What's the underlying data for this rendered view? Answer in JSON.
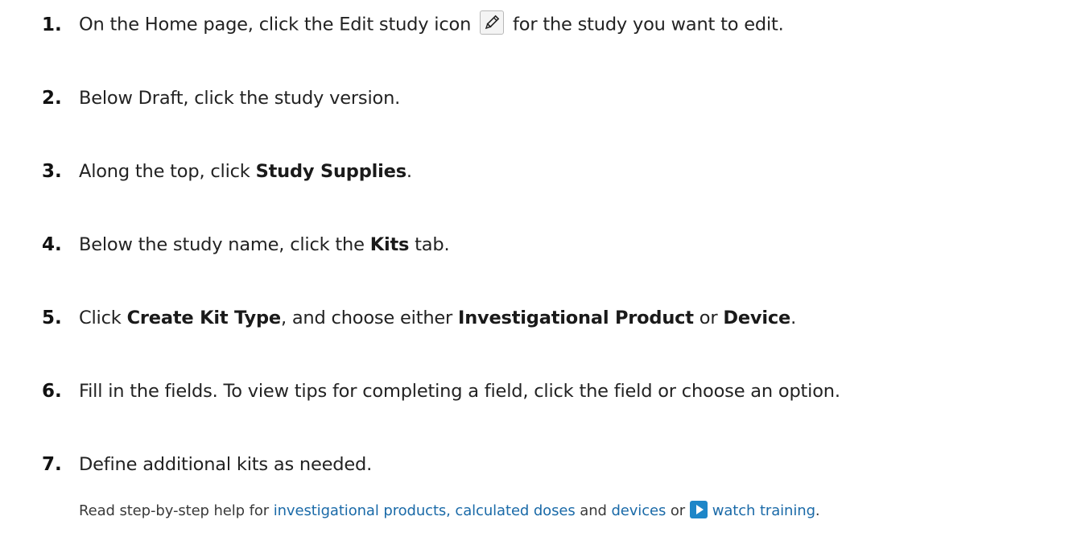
{
  "steps": [
    {
      "num": "1.",
      "parts": [
        "On the Home page, click the Edit study icon",
        "for the study you want to edit."
      ]
    },
    {
      "num": "2.",
      "parts": [
        "Below Draft, click the study version."
      ]
    },
    {
      "num": "3.",
      "parts": [
        "Along the top, click ",
        "Study Supplies",
        "."
      ]
    },
    {
      "num": "4.",
      "parts": [
        "Below the study name, click the ",
        "Kits",
        " tab."
      ]
    },
    {
      "num": "5.",
      "parts": [
        "Click ",
        "Create Kit Type",
        ", and choose either ",
        "Investigational Product",
        " or ",
        "Device",
        "."
      ]
    },
    {
      "num": "6.",
      "parts": [
        "Fill in the fields. To view tips for completing a field, click the field or choose an option."
      ]
    },
    {
      "num": "7.",
      "parts": [
        "Define additional kits as needed."
      ]
    }
  ],
  "help": {
    "prefix": "Read step-by-step help for ",
    "link_products": "investigational products, calculated doses",
    "and": " and ",
    "link_devices": "devices",
    "or": " or ",
    "link_training": "watch training",
    "suffix": "."
  },
  "icons": {
    "edit_study": "pencil-icon",
    "training": "video-play-icon"
  },
  "colors": {
    "link": "#1a6aa8",
    "video_icon": "#1d86c8"
  }
}
